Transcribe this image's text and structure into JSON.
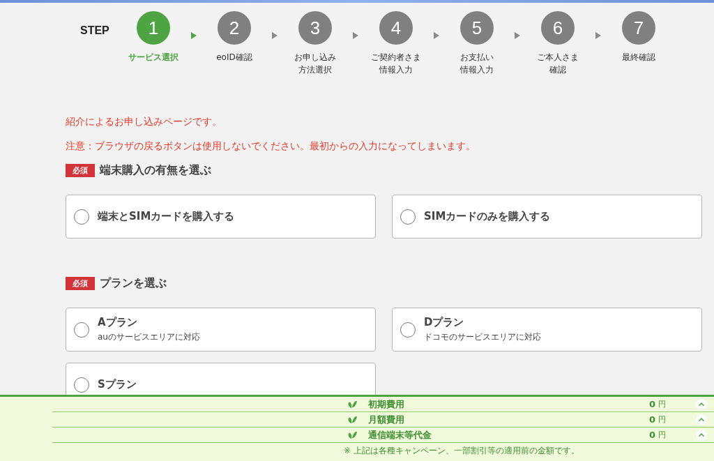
{
  "steps": {
    "title": "STEP",
    "items": [
      {
        "number": "1",
        "label_lines": [
          "サービス選択"
        ],
        "selected": true
      },
      {
        "number": "2",
        "label_lines": [
          "eoID確認"
        ],
        "selected": false
      },
      {
        "number": "3",
        "label_lines": [
          "お申し込み",
          "方法選択"
        ],
        "selected": false
      },
      {
        "number": "4",
        "label_lines": [
          "ご契約者さま",
          "情報入力"
        ],
        "selected": false
      },
      {
        "number": "5",
        "label_lines": [
          "お支払い",
          "情報入力"
        ],
        "selected": false
      },
      {
        "number": "6",
        "label_lines": [
          "ご本人さま",
          "確認"
        ],
        "selected": false
      },
      {
        "number": "7",
        "label_lines": [
          "最終確認"
        ],
        "selected": false
      }
    ]
  },
  "notices": [
    "紹介によるお申し込みページです。",
    "注意：ブラウザの戻るボタンは使用しないでください。最初からの入力になってしまいます。"
  ],
  "sections": [
    {
      "badge": "必須",
      "title": "端末購入の有無を選ぶ",
      "options": [
        {
          "title": "端末とSIMカードを購入する",
          "checked": false
        },
        {
          "title": "SIMカードのみを購入する",
          "checked": false
        }
      ]
    },
    {
      "badge": "必須",
      "title": "プランを選ぶ",
      "options": [
        {
          "title": "Aプラン",
          "subtitle": "auのサービスエリアに対応",
          "checked": false
        },
        {
          "title": "Dプラン",
          "subtitle": "ドコモのサービスエリアに対応",
          "checked": false
        },
        {
          "title": "Sプラン",
          "checked": false
        }
      ]
    }
  ],
  "footer": {
    "rows": [
      {
        "label": "初期費用",
        "amount": "0",
        "unit": "円"
      },
      {
        "label": "月額費用",
        "amount": "0",
        "unit": "円"
      },
      {
        "label": "通信端末等代金",
        "amount": "0",
        "unit": "円"
      }
    ],
    "note": "※ 上記は各種キャンペーン、一部割引等の適用前の金額です。"
  }
}
